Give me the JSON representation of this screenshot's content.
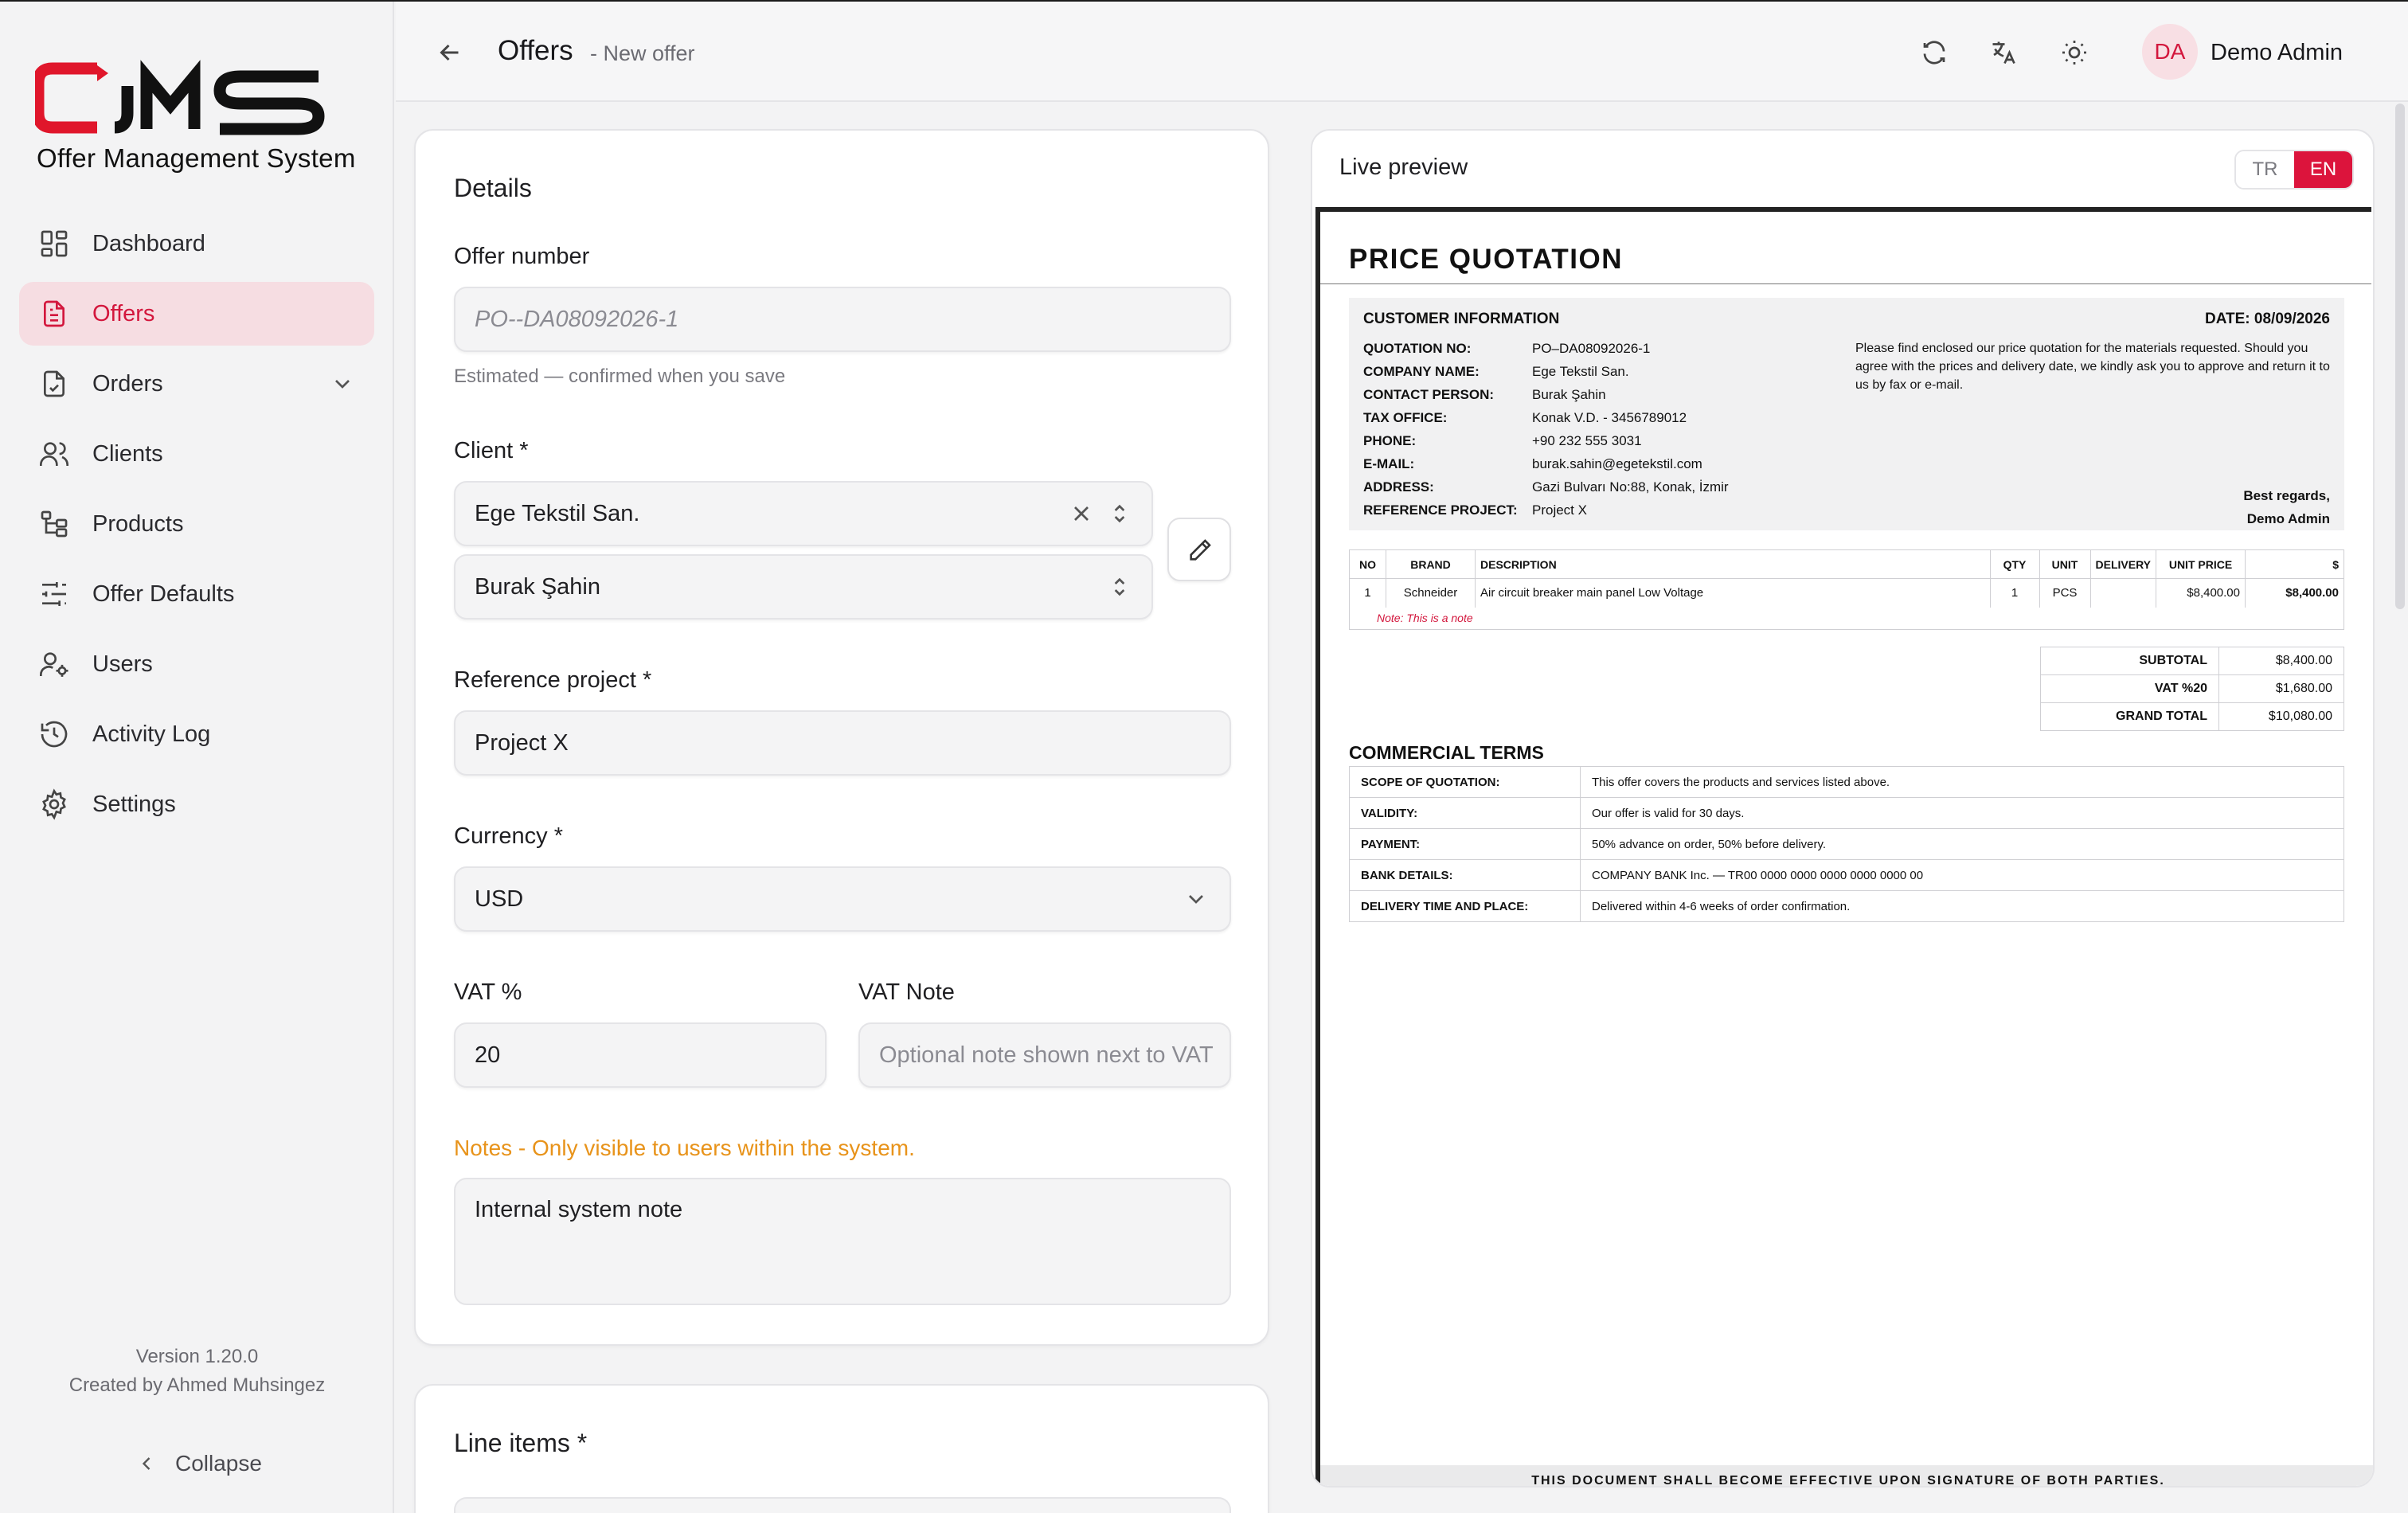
{
  "app": {
    "logo_text": "OMS",
    "logo_subtitle": "Offer Management System",
    "version": "Version 1.20.0",
    "credit": "Created by Ahmed Muhsingez",
    "collapse_label": "Collapse",
    "accent_color": "#dc143c"
  },
  "nav": {
    "items": [
      {
        "label": "Dashboard",
        "icon": "dashboard-icon"
      },
      {
        "label": "Offers",
        "icon": "document-icon",
        "active": true
      },
      {
        "label": "Orders",
        "icon": "order-icon",
        "expandable": true
      },
      {
        "label": "Clients",
        "icon": "users-icon"
      },
      {
        "label": "Products",
        "icon": "tree-icon"
      },
      {
        "label": "Offer Defaults",
        "icon": "sliders-icon"
      },
      {
        "label": "Users",
        "icon": "user-gear-icon"
      },
      {
        "label": "Activity Log",
        "icon": "history-icon"
      },
      {
        "label": "Settings",
        "icon": "gear-icon"
      }
    ]
  },
  "header": {
    "title": "Offers",
    "subtitle": "- New offer",
    "avatar_initials": "DA",
    "user_name": "Demo Admin"
  },
  "form": {
    "section_title": "Details",
    "offer_number_label": "Offer number",
    "offer_number_placeholder": "PO--DA08092026-1",
    "offer_number_help": "Estimated — confirmed when you save",
    "client_label": "Client *",
    "client_value": "Ege Tekstil San.",
    "contact_value": "Burak Şahin",
    "reference_label": "Reference project *",
    "reference_value": "Project X",
    "currency_label": "Currency *",
    "currency_value": "USD",
    "vat_label": "VAT %",
    "vat_value": "20",
    "vat_note_label": "VAT Note",
    "vat_note_placeholder": "Optional note shown next to VAT",
    "notes_label": "Notes - Only visible to users within the system.",
    "notes_value": "Internal system note",
    "line_items_title": "Line items *"
  },
  "preview": {
    "title": "Live preview",
    "lang_options": [
      "TR",
      "EN"
    ],
    "lang_selected": "EN",
    "doc_title": "PRICE QUOTATION",
    "customer_info_title": "CUSTOMER INFORMATION",
    "date": "DATE: 08/09/2026",
    "customer_rows": [
      {
        "k": "QUOTATION NO:",
        "v": "PO–DA08092026-1"
      },
      {
        "k": "COMPANY NAME:",
        "v": "Ege Tekstil San."
      },
      {
        "k": "CONTACT PERSON:",
        "v": "Burak Şahin"
      },
      {
        "k": "TAX OFFICE:",
        "v": "Konak V.D. - 3456789012"
      },
      {
        "k": "PHONE:",
        "v": "+90 232 555 3031"
      },
      {
        "k": "E-MAIL:",
        "v": "burak.sahin@egetekstil.com"
      },
      {
        "k": "ADDRESS:",
        "v": "Gazi Bulvarı No:88, Konak, İzmir"
      },
      {
        "k": "REFERENCE PROJECT:",
        "v": "Project X"
      }
    ],
    "message": "Please find enclosed our price quotation for the materials requested. Should you agree with the prices and delivery date, we kindly ask you to approve and return it to us by fax or e-mail.",
    "regards_1": "Best regards,",
    "regards_2": "Demo Admin",
    "item_headers": [
      "NO",
      "BRAND",
      "DESCRIPTION",
      "QTY",
      "UNIT",
      "DELIVERY",
      "UNIT PRICE",
      "$"
    ],
    "items": [
      {
        "no": "1",
        "brand": "Schneider",
        "description": "Air circuit breaker main panel Low Voltage",
        "qty": "1",
        "unit": "PCS",
        "delivery": "",
        "unit_price": "$8,400.00",
        "total": "$8,400.00"
      }
    ],
    "item_note": "Note: This is a note",
    "totals": [
      {
        "k": "SUBTOTAL",
        "v": "$8,400.00"
      },
      {
        "k": "VAT %20",
        "v": "$1,680.00"
      },
      {
        "k": "GRAND TOTAL",
        "v": "$10,080.00"
      }
    ],
    "terms_title": "COMMERCIAL TERMS",
    "terms": [
      {
        "k": "SCOPE OF QUOTATION:",
        "v": "This offer covers the products and services listed above."
      },
      {
        "k": "VALIDITY:",
        "v": "Our offer is valid for 30 days."
      },
      {
        "k": "PAYMENT:",
        "v": "50% advance on order, 50% before delivery."
      },
      {
        "k": "BANK DETAILS:",
        "v": "COMPANY BANK Inc. — TR00 0000 0000 0000 0000 0000 00"
      },
      {
        "k": "DELIVERY TIME AND PLACE:",
        "v": "Delivered within 4-6 weeks of order confirmation."
      }
    ],
    "footer_text": "THIS DOCUMENT SHALL BECOME EFFECTIVE UPON SIGNATURE OF BOTH PARTIES."
  }
}
